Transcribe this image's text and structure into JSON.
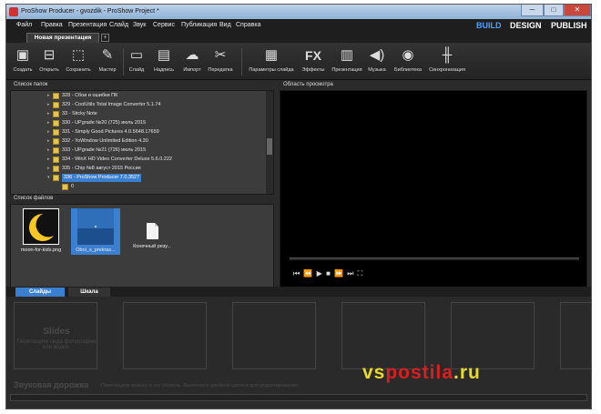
{
  "window": {
    "title": "ProShow Producer - gvozdik - ProShow Project *",
    "controls": [
      "─",
      "□",
      "✕"
    ]
  },
  "menu": [
    "Файл",
    "Правка",
    "Презентация",
    "Слайд",
    "Звук",
    "Сервис",
    "Публикация",
    "Вид",
    "Справка"
  ],
  "modes": {
    "build": "BUILD",
    "design": "DESIGN",
    "publish": "PUBLISH",
    "active": "BUILD"
  },
  "project_tab": {
    "label": "Новая презентация",
    "add": "+"
  },
  "toolbar": [
    {
      "label": "Создать",
      "icon": "new-project-icon",
      "glyph": "▣"
    },
    {
      "label": "Открыть",
      "icon": "open-folder-icon",
      "glyph": "⊟"
    },
    {
      "label": "Сохранить",
      "icon": "save-icon",
      "glyph": "⬚"
    },
    {
      "label": "Мастер",
      "icon": "wizard-icon",
      "glyph": "✎"
    },
    {
      "label": "Слайд",
      "icon": "slide-icon",
      "glyph": "▭"
    },
    {
      "label": "Надпись",
      "icon": "caption-icon",
      "glyph": "▤"
    },
    {
      "label": "Импорт",
      "icon": "import-icon",
      "glyph": "☁"
    },
    {
      "label": "Передатка",
      "icon": "effects-transfer-icon",
      "glyph": "✂"
    },
    {
      "label": "Параметры слайда",
      "icon": "slide-options-icon",
      "glyph": "▦"
    },
    {
      "label": "Эффекты",
      "icon": "fx-icon",
      "glyph": "FX"
    },
    {
      "label": "Презентация",
      "icon": "show-options-icon",
      "glyph": "▥"
    },
    {
      "label": "Музыка",
      "icon": "music-icon",
      "glyph": "◀)"
    },
    {
      "label": "Библиотека",
      "icon": "library-icon",
      "glyph": "◉"
    },
    {
      "label": "Синхронизация",
      "icon": "sync-icon",
      "glyph": "╫"
    }
  ],
  "folders": {
    "header": "Список папок",
    "items": [
      {
        "label": "328 - Сбои и ошибки ПК",
        "selected": false
      },
      {
        "label": "329 - CoolUtils Total Image Converter 5.1.74",
        "selected": false
      },
      {
        "label": "33 - Sticky Note",
        "selected": false
      },
      {
        "label": "330 - UPgrade №20 (725) июль 2015",
        "selected": false
      },
      {
        "label": "331 - Simply Good Pictures 4.0.5648.17659",
        "selected": false
      },
      {
        "label": "332 - YoWindow Unlimited Edition 4.30",
        "selected": false
      },
      {
        "label": "333 - UPgrade №21 (726) июль 2015",
        "selected": false
      },
      {
        "label": "334 - WinX HD Video Converter Deluxe 5.6.0.222",
        "selected": false
      },
      {
        "label": "335 - Chip №8 август 2015 Россия",
        "selected": false
      },
      {
        "label": "336 - ProShow Producer 7.0.3527",
        "selected": true
      },
      {
        "label": "0",
        "selected": false
      }
    ]
  },
  "files": {
    "header": "Список файлов",
    "items": [
      {
        "label": "moon-for-kids.png",
        "kind": "moon"
      },
      {
        "label": "Oboi_s_prekras...",
        "kind": "wallpaper"
      },
      {
        "label": "Конечный резу...",
        "kind": "document"
      }
    ]
  },
  "preview": {
    "header": "Область просмотра",
    "controls": "⏮ ⏪ ▶ ■ ⏩ ⏭ ⛶"
  },
  "bottom_tabs": [
    "Слайды",
    "Шкала"
  ],
  "slides": {
    "title": "Slides",
    "hint": "Перетащите сюда фотографии или видео."
  },
  "audio": {
    "title": "Звуковая дорожка",
    "hint": "Перетащите музыку в эту область. Выполните двойной щелчок для редактирования."
  },
  "watermark": {
    "a": "vs",
    "b": "postila",
    "c": ".ru"
  }
}
